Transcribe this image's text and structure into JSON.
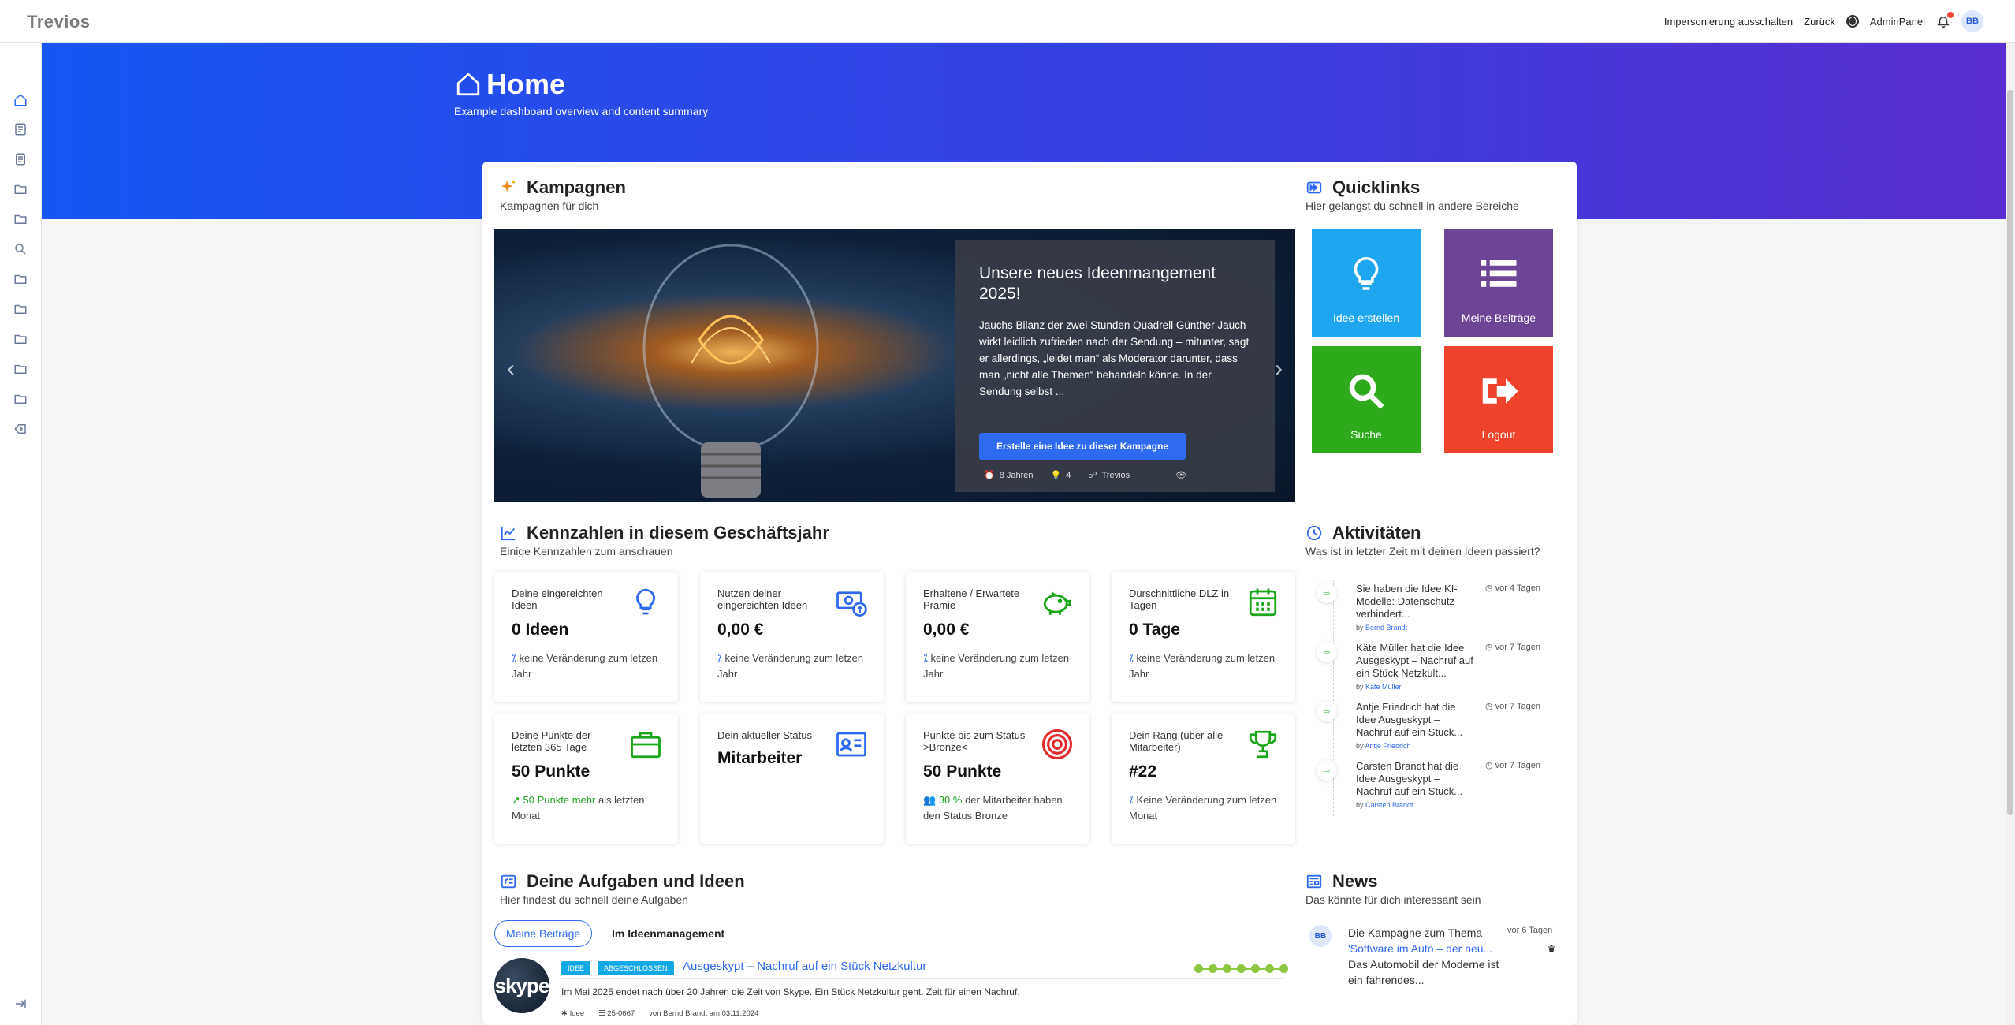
{
  "app": {
    "logo": "Trevios"
  },
  "topbar": {
    "impersonation": "Impersonierung ausschalten",
    "back": "Zurück",
    "admin": "AdminPanel",
    "avatar": "BB"
  },
  "sidebar": {
    "icons": [
      "home-icon",
      "document-icon",
      "document-icon",
      "folder-icon",
      "folder-icon",
      "search-icon",
      "folder-icon",
      "folder-icon",
      "folder-icon",
      "folder-icon",
      "folder-icon",
      "logout-icon"
    ],
    "collapse_icon": "collapse-arrow-icon"
  },
  "hero": {
    "title": "Home",
    "subtitle": "Example dashboard overview and content summary"
  },
  "campaigns": {
    "title": "Kampagnen",
    "subtitle": "Kampagnen für dich",
    "slide": {
      "title": "Unsere neues Ideenmangement 2025!",
      "text": "Jauchs Bilanz der zwei Stunden Quadrell Günther Jauch wirkt leidlich zufrieden nach der Sendung – mitunter, sagt er allerdings, „leidet man“ als Moderator darunter, dass man „nicht alle Themen“ behandeln könne. In der Sendung selbst ...",
      "button": "Erstelle eine Idee zu dieser Kampagne",
      "meta_time": "8 Jahren",
      "meta_ideas": "4",
      "meta_owner": "Trevios"
    }
  },
  "quicklinks": {
    "title": "Quicklinks",
    "subtitle": "Hier gelangst du schnell in andere Bereiche",
    "items": [
      {
        "label": "Idee erstellen",
        "color": "#1ea7f0"
      },
      {
        "label": "Meine Beiträge",
        "color": "#6c4596"
      },
      {
        "label": "Suche",
        "color": "#2faa1d"
      },
      {
        "label": "Logout",
        "color": "#f0432b"
      }
    ]
  },
  "kpis": {
    "title": "Kennzahlen in diesem Geschäftsjahr",
    "subtitle": "Einige Kennzahlen zum anschauen",
    "items": [
      {
        "label": "Deine eingereichten Ideen",
        "value": "0 Ideen",
        "note": "keine Veränderung zum letzen Jahr"
      },
      {
        "label": "Nutzen deiner eingereichten Ideen",
        "value": "0,00 €",
        "note": "keine Veränderung zum letzen Jahr"
      },
      {
        "label": "Erhaltene / Erwartete Prämie",
        "value": "0,00 €",
        "note": "keine Veränderung zum letzen Jahr"
      },
      {
        "label": "Durschnittliche DLZ in Tagen",
        "value": "0 Tage",
        "note": "keine Veränderung zum letzen Jahr"
      },
      {
        "label": "Deine Punkte der letzten 365 Tage",
        "value": "50 Punkte",
        "note_hl": "50 Punkte mehr",
        "note": "als letzten Monat"
      },
      {
        "label": "Dein aktueller Status",
        "value": "Mitarbeiter"
      },
      {
        "label": "Punkte bis zum Status >Bronze<",
        "value": "50 Punkte",
        "note_hl": "30 %",
        "note": "der Mitarbeiter haben den Status Bronze"
      },
      {
        "label": "Dein Rang (über alle Mitarbeiter)",
        "value": "#22",
        "note": "Keine Veränderung zum letzen Monat"
      }
    ]
  },
  "activities": {
    "title": "Aktivitäten",
    "subtitle": "Was ist in letzter Zeit mit deinen Ideen passiert?",
    "items": [
      {
        "text": "Sie haben die Idee KI-Modelle: Datenschutz verhindert...",
        "by": "Bernd Brandt",
        "time": "vor 4 Tagen"
      },
      {
        "text": "Käte Müller hat die Idee Ausgeskypt – Nachruf auf ein Stück Netzkult...",
        "by": "Käte Müller",
        "time": "vor 7 Tagen"
      },
      {
        "text": "Antje Friedrich hat die Idee Ausgeskypt – Nachruf auf ein Stück...",
        "by": "Antje Friedrich",
        "time": "vor 7 Tagen"
      },
      {
        "text": "Carsten Brandt hat die Idee Ausgeskypt – Nachruf auf ein Stück...",
        "by": "Carsten Brandt",
        "time": "vor 7 Tagen"
      }
    ],
    "by_prefix": "by"
  },
  "tasks": {
    "title": "Deine Aufgaben und Ideen",
    "subtitle": "Hier findest du schnell deine Aufgaben",
    "tab_active": "Meine Beiträge",
    "tab_other": "Im Ideenmanagement",
    "item": {
      "avatar_text": "skype",
      "badge1": "IDEE",
      "badge2": "ABGESCHLOSSEN",
      "title": "Ausgeskypt – Nachruf auf ein Stück Netzkultur",
      "desc": "Im Mai 2025 endet nach über 20 Jahren die Zeit von Skype. Ein Stück Netzkultur geht. Zeit für einen Nachruf.",
      "type": "Idee",
      "number": "25-0667",
      "author": "von Bernd Brandt am 03.11.2024",
      "progress_steps": 7
    }
  },
  "news": {
    "title": "News",
    "subtitle": "Das könnte für dich interessant sein",
    "item": {
      "avatar": "BB",
      "text_pre": "Die Kampagne zum Thema",
      "link": "'Software im Auto – der neu...",
      "text_post": "Das Automobil der Moderne ist ein fahrendes...",
      "time": "vor 6 Tagen"
    }
  }
}
